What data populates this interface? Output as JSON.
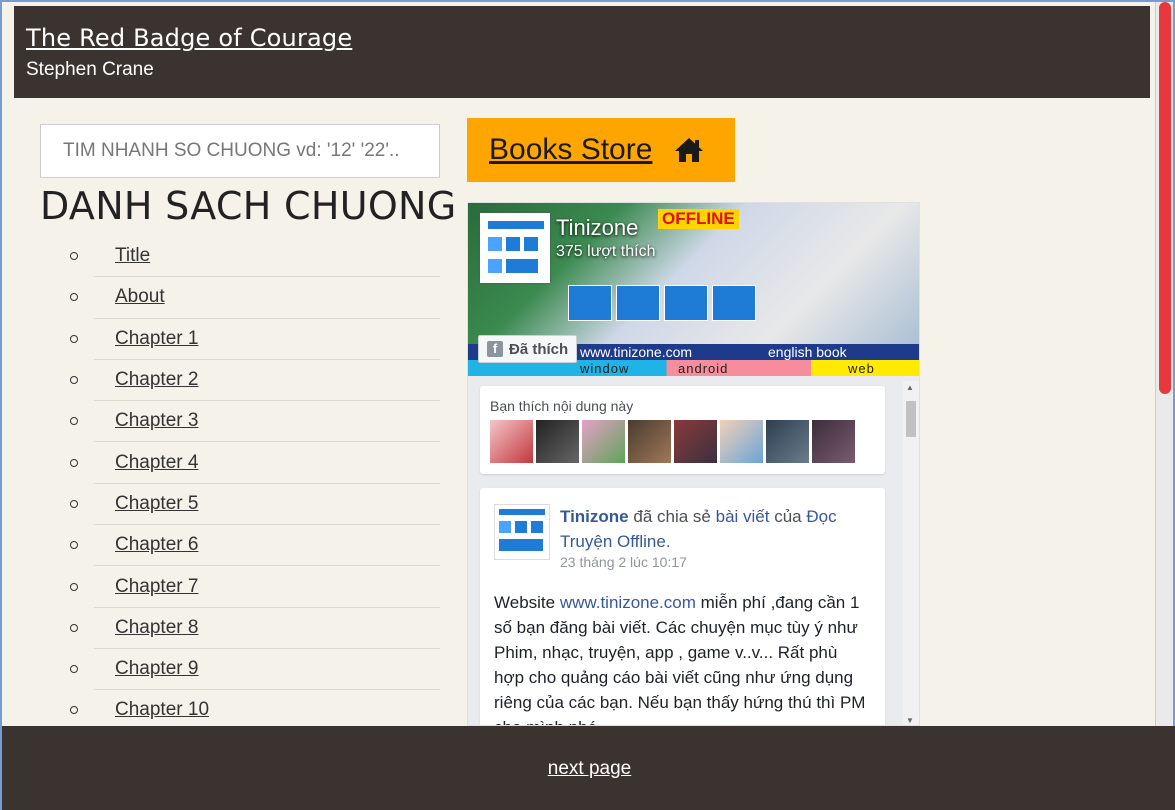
{
  "header": {
    "title": "The Red Badge of Courage",
    "author": "Stephen Crane"
  },
  "search": {
    "placeholder": "TIM NHANH SO CHUONG vd: '12' '22'.."
  },
  "chapter_list": {
    "heading": "DANH SACH CHUONG",
    "items": [
      "Title",
      "About",
      "Chapter 1",
      "Chapter 2",
      "Chapter 3",
      "Chapter 4",
      "Chapter 5",
      "Chapter 6",
      "Chapter 7",
      "Chapter 8",
      "Chapter 9",
      "Chapter 10"
    ]
  },
  "store": {
    "label": "Books Store",
    "icon": "home-icon"
  },
  "facebook_widget": {
    "page_name": "Tinizone",
    "likes": "375 lượt thích",
    "liked_button": "Đã thích",
    "cover": {
      "promo": "OFFLINE",
      "band_text_left": "www.tinizone.com",
      "band_text_right": "english book",
      "platforms": [
        "window",
        "android",
        "web"
      ]
    },
    "likers_title": "Bạn thích nội dung này",
    "post": {
      "author": "Tinizone",
      "shared_text": "đã chia sẻ",
      "link_text": "bài viết",
      "of_text": "của",
      "target": "Đọc Truyện Offline.",
      "date": "23 tháng 2 lúc 10:17",
      "body_prefix": "Website",
      "body_link": "www.tinizone.com",
      "body_rest": "miễn phí ,đang cần 1 số bạn đăng bài viết. Các chuyện mục tùy ý như Phim, nhạc, truyện, app , game v..v... Rất phù hợp cho quảng cáo bài viết cũng như ứng dụng riêng của các bạn. Nếu bạn thấy hứng thú thì PM cho mình nhé"
    }
  },
  "footer": {
    "next_label": "next page"
  },
  "colors": {
    "header_bg": "#3b3330",
    "page_bg": "#f5f2ea",
    "store_bg": "#ffa500",
    "fb_link": "#365899"
  }
}
